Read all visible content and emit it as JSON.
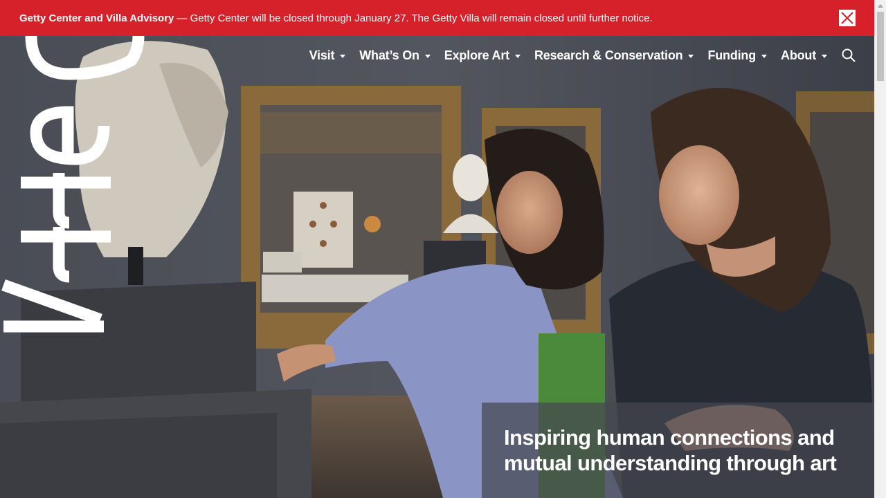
{
  "advisory": {
    "title": "Getty Center and Villa Advisory",
    "text": "— Getty Center will be closed through January 27. The Getty Villa will remain closed until further notice.",
    "close_icon": "close-icon",
    "background_color": "#d6202a"
  },
  "brand": {
    "logo_text": "Getty"
  },
  "nav": {
    "items": [
      {
        "label": "Visit"
      },
      {
        "label": "What’s On"
      },
      {
        "label": "Explore Art"
      },
      {
        "label": "Research & Conservation"
      },
      {
        "label": "Funding"
      },
      {
        "label": "About"
      }
    ],
    "search_icon": "search-icon"
  },
  "hero": {
    "tagline": "Inspiring human connections and mutual understanding through art",
    "image_description_icon": "hero-photo"
  }
}
